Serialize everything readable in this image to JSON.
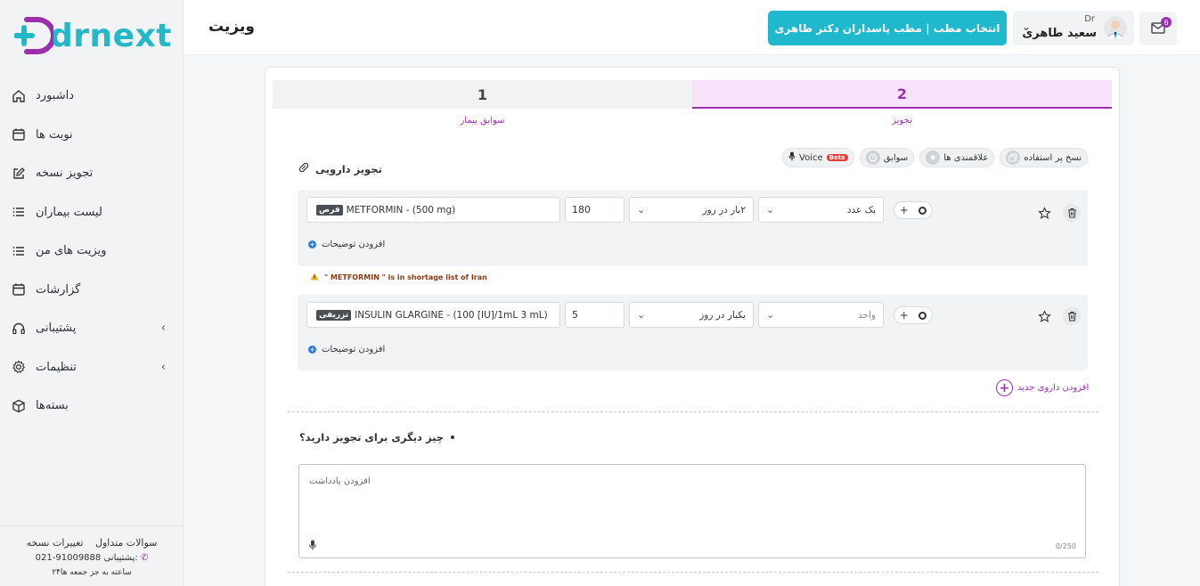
{
  "brand": {
    "logo_text": "drnext"
  },
  "sidebar": {
    "items": [
      {
        "label": "داشبورد",
        "icon": "home-icon"
      },
      {
        "label": "نوبت ها",
        "icon": "calendar-icon"
      },
      {
        "label": "تجویز نسخه",
        "icon": "edit-icon"
      },
      {
        "label": "لیست بیماران",
        "icon": "list-icon"
      },
      {
        "label": "ویزیت های من",
        "icon": "list-icon"
      },
      {
        "label": "گزارشات",
        "icon": "calendar-icon"
      },
      {
        "label": "پشتیبانی",
        "icon": "headset-icon",
        "has_submenu": true
      },
      {
        "label": "تنظیمات",
        "icon": "gear-icon",
        "has_submenu": true
      },
      {
        "label": "بسته‌ها",
        "icon": "package-icon"
      }
    ],
    "footer": {
      "faq": "سوالات متداول",
      "changes": "تغییرات نسخه",
      "support_label": "پشتیبانی:",
      "support_phone": "021-91009888",
      "hours": "۲۴ساعته به جز جمعه ها"
    }
  },
  "header": {
    "title": "ویزیت",
    "clinic_button": "انتخاب مطب | مطب پاسداران دکتر طاهری",
    "user_role": "Dr",
    "user_name": "سعید طاهری",
    "notification_count": "6"
  },
  "steps": {
    "step1_number": "1",
    "step1_label": "سوابق بیمار",
    "step2_number": "2",
    "step2_label": "تجویز",
    "active": 2
  },
  "prescription": {
    "section_title": "تجویز دارویی",
    "chips": {
      "copy": "نسخ پر استفاده",
      "favorites": "علاقمندی ها",
      "history": "سوابق",
      "voice": "Voice",
      "beta": "Beta"
    },
    "drugs": [
      {
        "form": "قرص",
        "name": "METFORMIN - (500 mg)",
        "qty": "180",
        "frequency": "۲بار در روز",
        "dose": "یک عدد",
        "add_desc": "افزودن توضیحات"
      },
      {
        "form": "تزریقی",
        "name": "INSULIN GLARGINE - (100 [IU]/1mL 3 mL)",
        "qty": "5",
        "frequency": "یکبار در روز",
        "dose": "واحد",
        "add_desc": "افزودن توضیحات"
      }
    ],
    "warning": "\" METFORMIN \" is in shortage list of Iran",
    "add_drug": "افزودن داروی جدید"
  },
  "notes": {
    "question": "چیز دیگری برای تجویز دارید؟",
    "placeholder": "افزودن یادداشت",
    "counter": "0/250"
  },
  "colors": {
    "accent": "#20b8cc",
    "purple": "#9b2fae",
    "step_active_bg": "#f7e3fb"
  }
}
